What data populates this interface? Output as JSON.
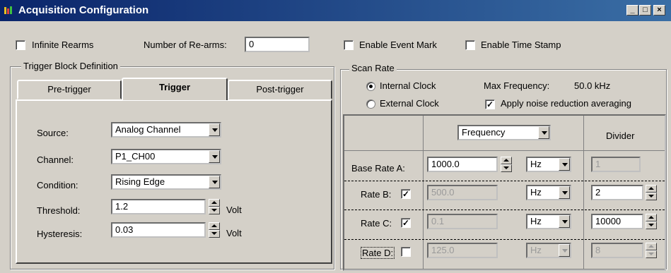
{
  "window": {
    "title": "Acquisition Configuration"
  },
  "top": {
    "infinite_rearms": "Infinite Rearms",
    "num_rearms_label": "Number of Re-arms:",
    "num_rearms_value": "0",
    "event_mark": "Enable Event Mark",
    "time_stamp": "Enable Time Stamp"
  },
  "trigger_block": {
    "title": "Trigger Block Definition",
    "tabs": [
      "Pre-trigger",
      "Trigger",
      "Post-trigger"
    ],
    "source_label": "Source:",
    "source_value": "Analog Channel",
    "channel_label": "Channel:",
    "channel_value": "P1_CH00",
    "condition_label": "Condition:",
    "condition_value": "Rising Edge",
    "threshold_label": "Threshold:",
    "threshold_value": "1.2",
    "threshold_unit": "Volt",
    "hysteresis_label": "Hysteresis:",
    "hysteresis_value": "0.03",
    "hysteresis_unit": "Volt"
  },
  "scan_rate": {
    "title": "Scan Rate",
    "internal_clock": "Internal Clock",
    "external_clock": "External Clock",
    "max_freq_label": "Max Frequency:",
    "max_freq_value": "50.0 kHz",
    "noise_reduction": "Apply noise reduction averaging",
    "freq_select": "Frequency",
    "divider_header": "Divider",
    "rows": [
      {
        "label": "Base Rate A:",
        "value": "1000.0",
        "unit": "Hz",
        "divider": "1"
      },
      {
        "label": "Rate B:",
        "value": "500.0",
        "unit": "Hz",
        "divider": "2"
      },
      {
        "label": "Rate C:",
        "value": "0.1",
        "unit": "Hz",
        "divider": "10000"
      },
      {
        "label": "Rate D:",
        "value": "125.0",
        "unit": "Hz",
        "divider": "8"
      }
    ]
  },
  "colors": {
    "titlebar_start": "#0a246a",
    "titlebar_end": "#3a6ea5",
    "face": "#d4d0c8"
  }
}
